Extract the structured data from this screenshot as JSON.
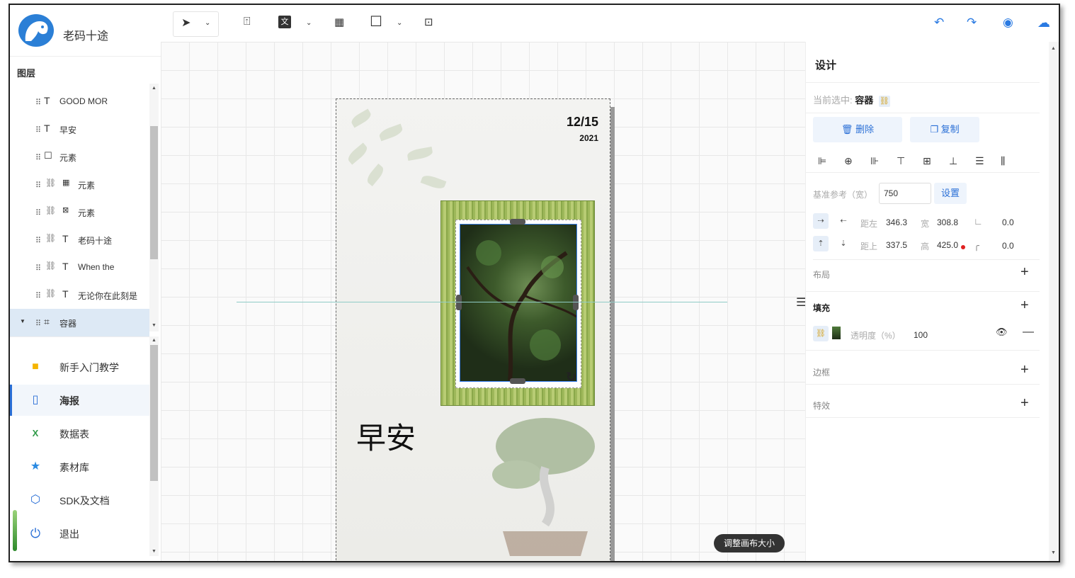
{
  "app": {
    "title": "老码十途"
  },
  "layers": {
    "title": "图层",
    "items": [
      {
        "icon": "T",
        "label": "GOOD MOR"
      },
      {
        "icon": "T",
        "label": "早安"
      },
      {
        "icon": "☐",
        "label": "元素"
      },
      {
        "icon": "▦",
        "label": "元素"
      },
      {
        "icon": "⊠",
        "label": "元素"
      },
      {
        "icon": "T",
        "label": "老码十途"
      },
      {
        "icon": "T",
        "label": "When the"
      },
      {
        "icon": "T",
        "label": "无论你在此刻是"
      },
      {
        "icon": "⌗",
        "label": "容器"
      }
    ]
  },
  "nav": {
    "items": [
      {
        "label": "新手入门教学"
      },
      {
        "label": "海报"
      },
      {
        "label": "数据表"
      },
      {
        "label": "素材库"
      },
      {
        "label": "SDK及文档"
      },
      {
        "label": "退出"
      }
    ]
  },
  "canvas": {
    "date": "12/15",
    "year": "2021",
    "morning": "早安",
    "resize_btn": "调整画布大小"
  },
  "panel": {
    "title": "设计",
    "current_label": "当前选中:",
    "current_value": "容器",
    "delete": "删除",
    "copy": "复制",
    "base_ref_label": "基准参考（宽）",
    "base_ref_value": "750",
    "set_btn": "设置",
    "left_label": "距左",
    "left_value": "346.3",
    "width_label": "宽",
    "width_value": "308.8",
    "angle_value": "0.0",
    "top_label": "距上",
    "top_value": "337.5",
    "height_label": "高",
    "height_value": "425.0",
    "radius_value": "0.0",
    "layout": "布局",
    "fill": "填充",
    "opacity_label": "透明度（%）",
    "opacity_value": "100",
    "border": "边框",
    "effects": "特效"
  },
  "colors": {
    "accent": "#2a6fd6",
    "selection": "#3b82f6"
  }
}
